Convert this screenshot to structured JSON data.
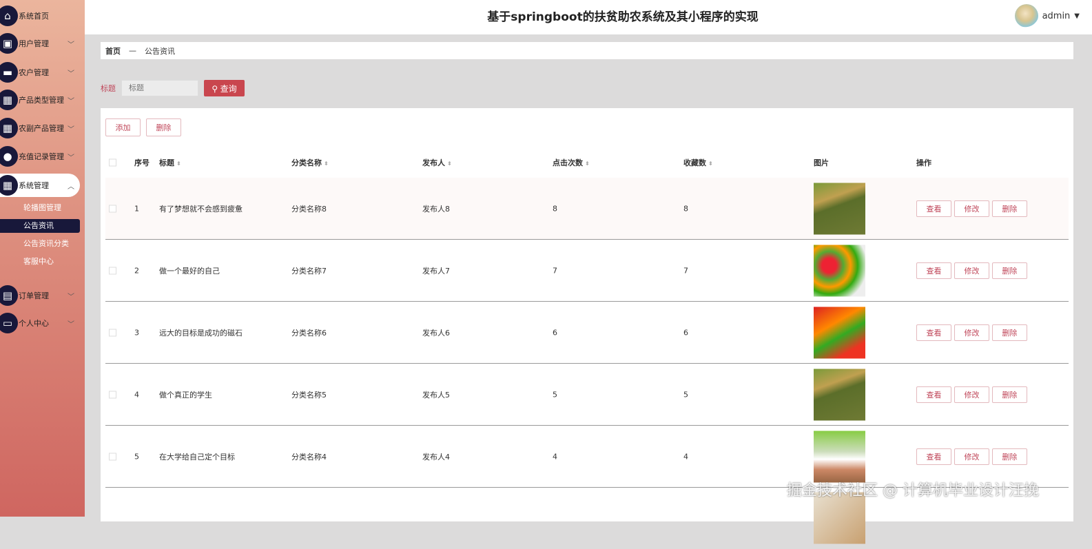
{
  "header": {
    "title": "基于springboot的扶贫助农系统及其小程序的实现",
    "user": "admin"
  },
  "sidebar": {
    "items": [
      {
        "label": "系统首页",
        "icon": "home-icon"
      },
      {
        "label": "用户管理",
        "icon": "wallet-icon"
      },
      {
        "label": "农户管理",
        "icon": "monitor-icon"
      },
      {
        "label": "产品类型管理",
        "icon": "grid-icon"
      },
      {
        "label": "农副产品管理",
        "icon": "grid-icon"
      },
      {
        "label": "充值记录管理",
        "icon": "user-icon"
      },
      {
        "label": "系统管理",
        "icon": "grid-icon"
      },
      {
        "label": "订单管理",
        "icon": "clipboard-icon"
      },
      {
        "label": "个人中心",
        "icon": "card-icon"
      }
    ],
    "sub": [
      "轮播图管理",
      "公告资讯",
      "公告资讯分类",
      "客服中心"
    ]
  },
  "breadcrumb": {
    "home": "首页",
    "sep": "—",
    "current": "公告资讯"
  },
  "search": {
    "label": "标题",
    "placeholder": "标题",
    "button": "查询"
  },
  "toolbar": {
    "add": "添加",
    "delete": "删除"
  },
  "table": {
    "headers": [
      "序号",
      "标题",
      "分类名称",
      "发布人",
      "点击次数",
      "收藏数",
      "图片",
      "操作"
    ],
    "actions": [
      "查看",
      "修改",
      "删除"
    ],
    "rows": [
      {
        "no": "1",
        "title": "有了梦想就不会感到疲惫",
        "cat": "分类名称8",
        "pub": "发布人8",
        "clicks": "8",
        "fav": "8"
      },
      {
        "no": "2",
        "title": "做一个最好的自己",
        "cat": "分类名称7",
        "pub": "发布人7",
        "clicks": "7",
        "fav": "7"
      },
      {
        "no": "3",
        "title": "远大的目标是成功的磁石",
        "cat": "分类名称6",
        "pub": "发布人6",
        "clicks": "6",
        "fav": "6"
      },
      {
        "no": "4",
        "title": "做个真正的学生",
        "cat": "分类名称5",
        "pub": "发布人5",
        "clicks": "5",
        "fav": "5"
      },
      {
        "no": "5",
        "title": "在大学给自己定个目标",
        "cat": "分类名称4",
        "pub": "发布人4",
        "clicks": "4",
        "fav": "4"
      }
    ]
  },
  "watermark": "掘金技术社区 @ 计算机毕业设计汪挽"
}
